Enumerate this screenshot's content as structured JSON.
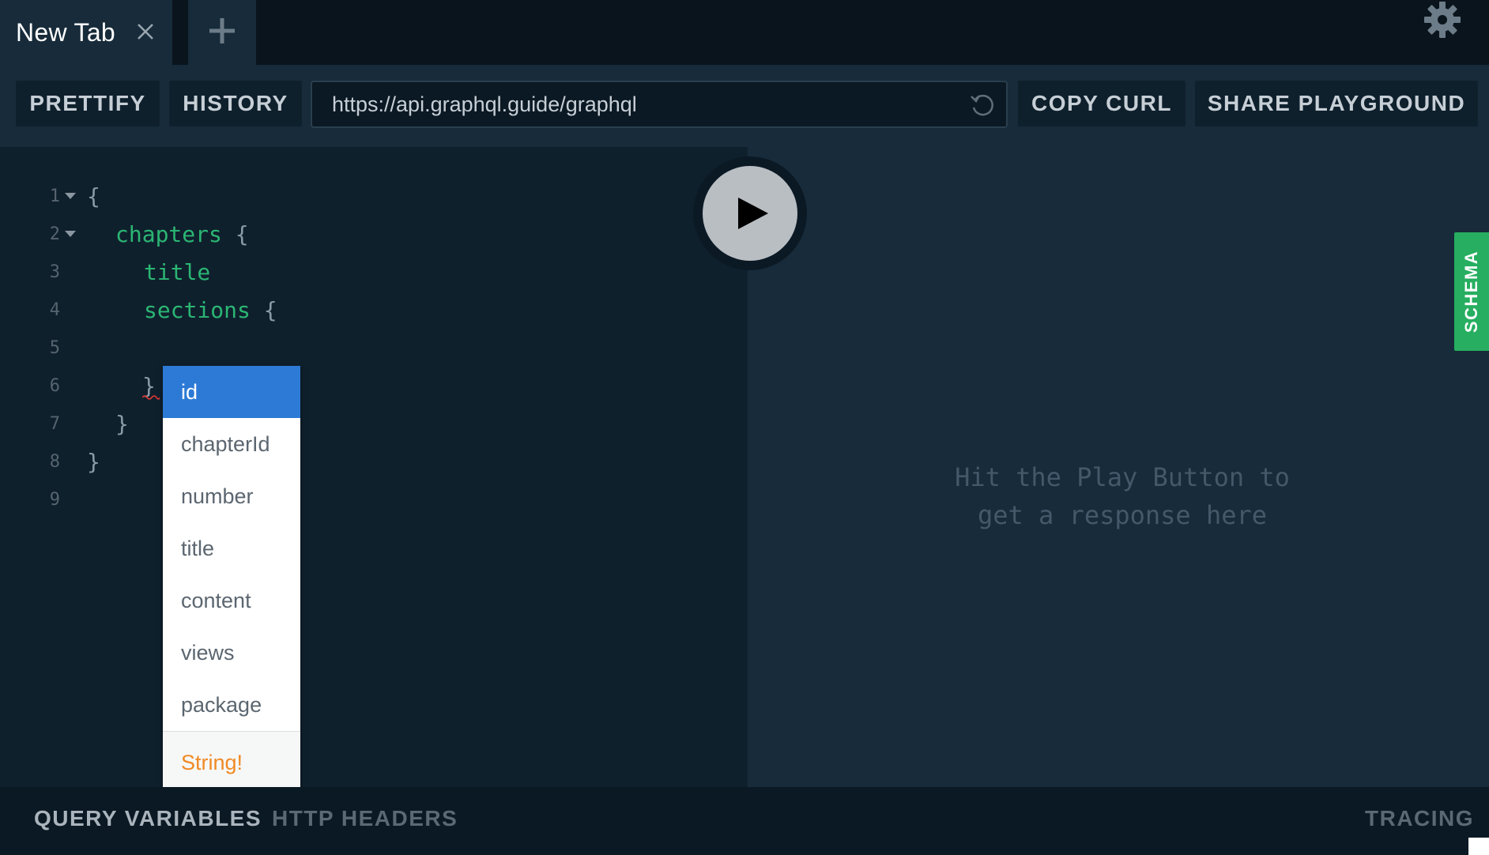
{
  "tabs": [
    {
      "title": "New Tab"
    }
  ],
  "toolbar": {
    "prettify_label": "PRETTIFY",
    "history_label": "HISTORY",
    "endpoint_url": "https://api.graphql.guide/graphql",
    "copy_curl_label": "COPY CURL",
    "share_label": "SHARE PLAYGROUND"
  },
  "editor": {
    "line_numbers": [
      "1",
      "2",
      "3",
      "4",
      "5",
      "6",
      "7",
      "8",
      "9"
    ],
    "lines": {
      "l1": "{",
      "l2_field": "chapters",
      "l2_brace": " {",
      "l3_field": "title",
      "l4_field": "sections",
      "l4_brace": " {",
      "l6": "}",
      "l7": "}",
      "l8": "}"
    }
  },
  "autocomplete": {
    "items": [
      "id",
      "chapterId",
      "number",
      "title",
      "content",
      "views",
      "package"
    ],
    "selected": "id",
    "type_hint": "String!"
  },
  "result": {
    "placeholder_line1": "Hit the Play Button to",
    "placeholder_line2": "get a response here"
  },
  "schema_tab_label": "SCHEMA",
  "bottom": {
    "query_variables_label": "QUERY VARIABLES",
    "http_headers_label": "HTTP HEADERS",
    "tracing_label": "TRACING"
  },
  "colors": {
    "accent_green": "#27ae60",
    "field_green": "#2bb673",
    "selection_blue": "#2d7ad6",
    "type_orange": "#f08a24"
  },
  "icons": [
    "close-icon",
    "plus-icon",
    "gear-icon",
    "reload-icon",
    "play-icon"
  ]
}
